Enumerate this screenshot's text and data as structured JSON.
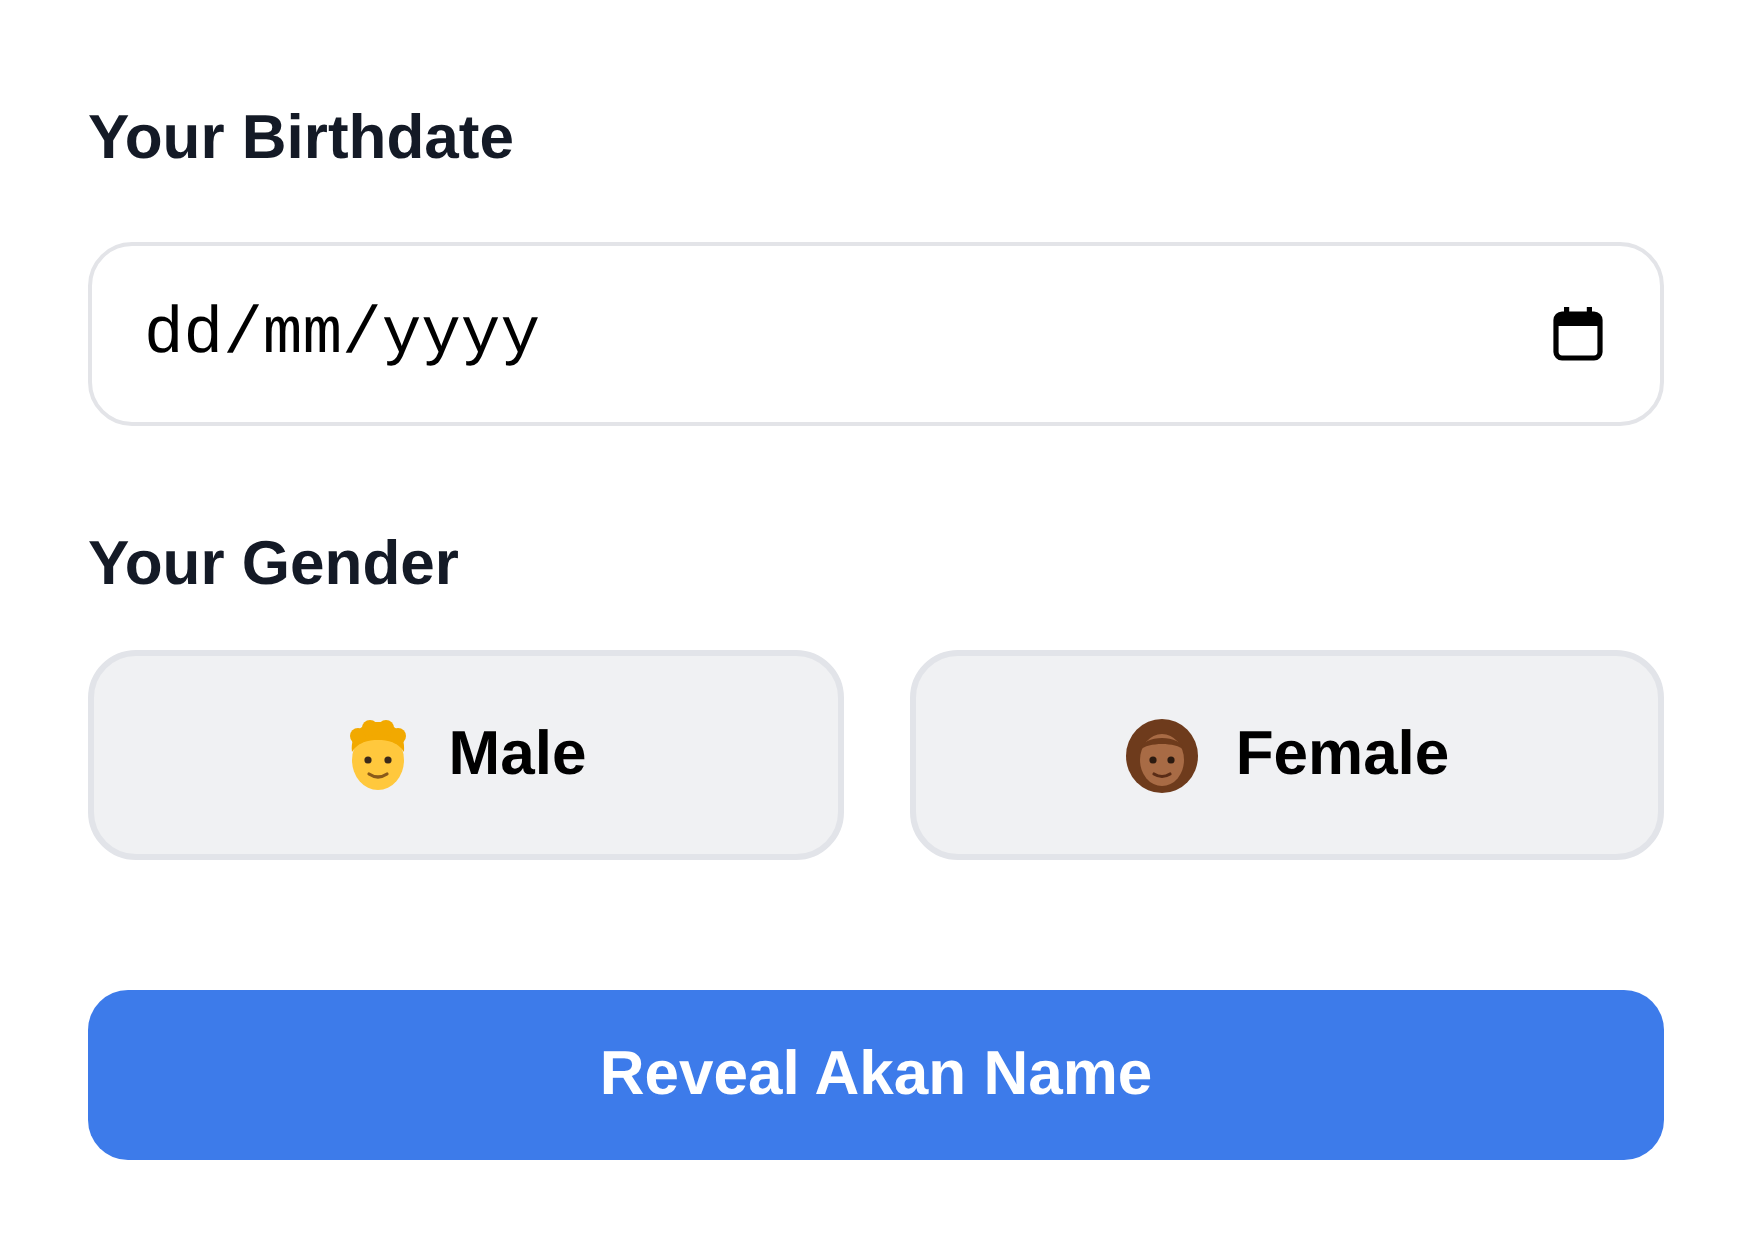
{
  "birthdate": {
    "label": "Your Birthdate",
    "field": {
      "placeholder": "dd/mm/yyyy"
    }
  },
  "gender": {
    "label": "Your Gender",
    "options": [
      {
        "label": "Male",
        "selected": false
      },
      {
        "label": "Female",
        "selected": false
      }
    ]
  },
  "submit_button": "Reveal Akan Name"
}
